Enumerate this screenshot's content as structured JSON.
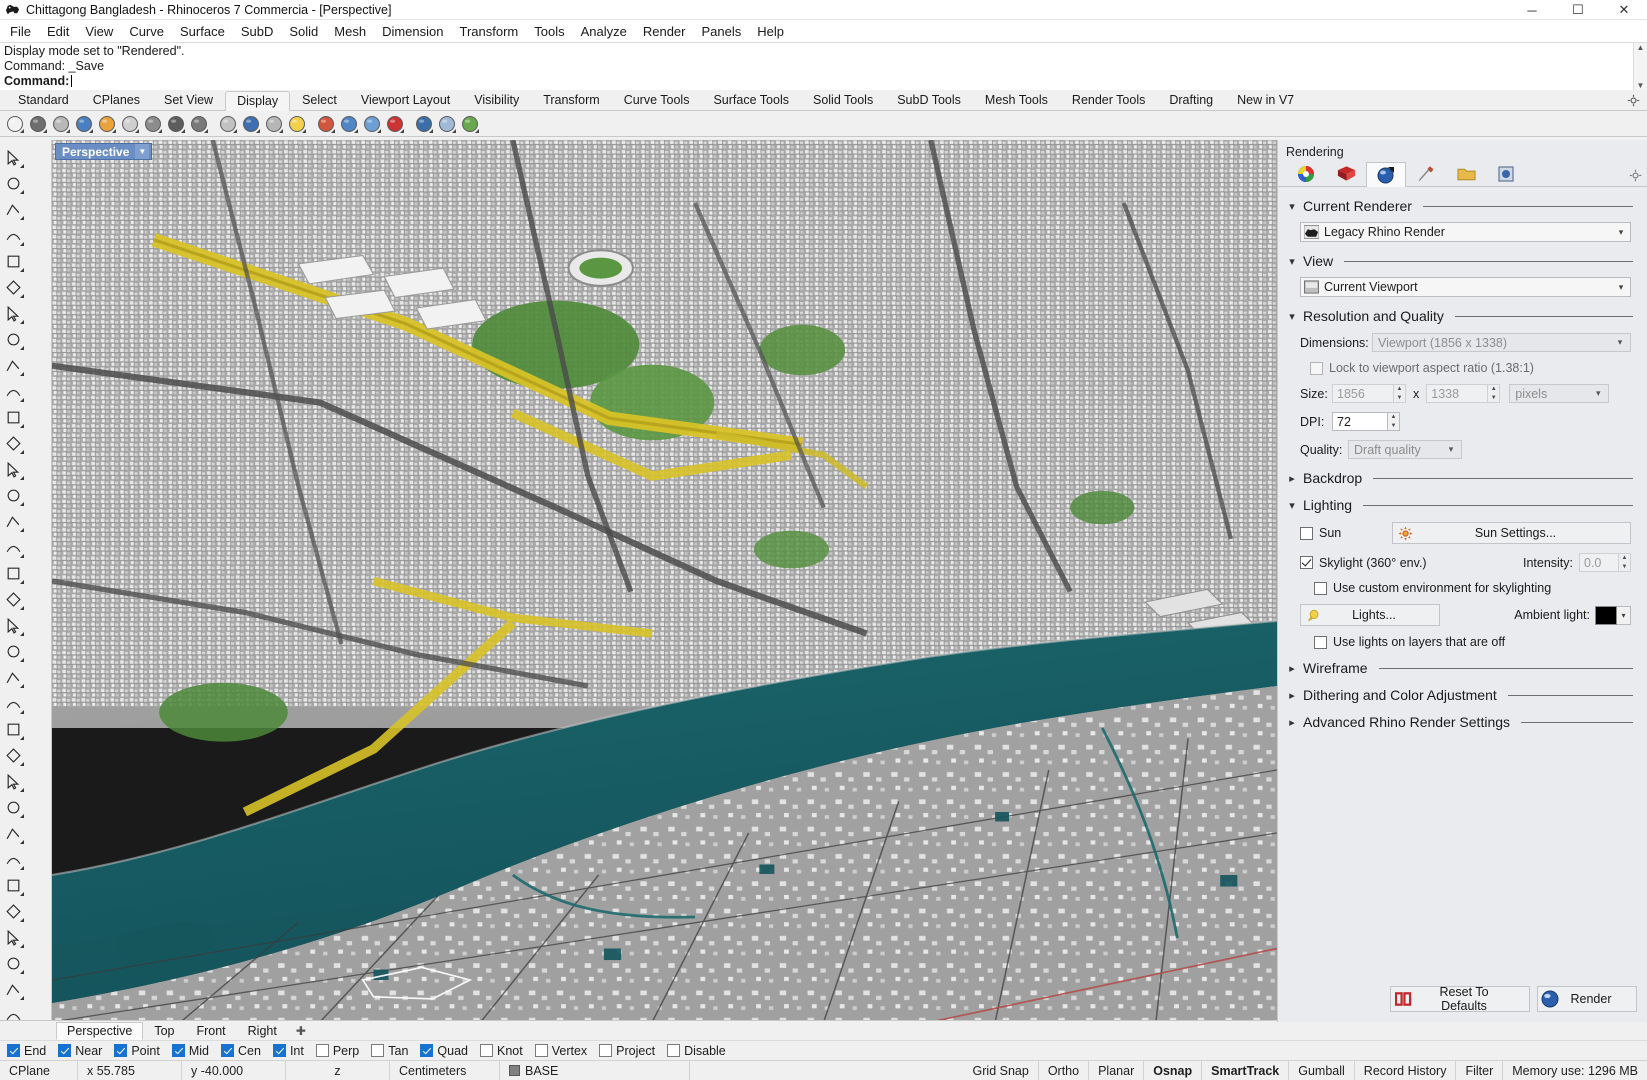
{
  "window": {
    "title": "Chittagong Bangladesh - Rhinoceros 7 Commercia - [Perspective]",
    "app_icon": "rhino-logo-icon",
    "minimize": "─",
    "maximize": "☐",
    "close": "✕"
  },
  "menu": {
    "items": [
      "File",
      "Edit",
      "View",
      "Curve",
      "Surface",
      "SubD",
      "Solid",
      "Mesh",
      "Dimension",
      "Transform",
      "Tools",
      "Analyze",
      "Render",
      "Panels",
      "Help"
    ]
  },
  "command_area": {
    "history": [
      "Display mode set to \"Rendered\".",
      "Command: _Save"
    ],
    "prompt": "Command:",
    "input_value": "",
    "scroll_up": "▲",
    "scroll_down": "▼"
  },
  "toolbar_tabs": {
    "items": [
      "Standard",
      "CPlanes",
      "Set View",
      "Display",
      "Select",
      "Viewport Layout",
      "Visibility",
      "Transform",
      "Curve Tools",
      "Surface Tools",
      "Solid Tools",
      "SubD Tools",
      "Mesh Tools",
      "Render Tools",
      "Drafting",
      "New in V7"
    ],
    "active": "Display",
    "options_icon": "gear-icon"
  },
  "display_toolbar": {
    "icons": [
      {
        "name": "wireframe-display-icon",
        "color": "#f2f2f2"
      },
      {
        "name": "shaded-display-icon",
        "color": "#6e6e6e"
      },
      {
        "name": "ghosted-display-icon",
        "color": "#b8b8b8"
      },
      {
        "name": "rendered-display-icon",
        "color": "#4a7fc1"
      },
      {
        "name": "arctic-display-icon",
        "color": "#e8a33d"
      },
      {
        "name": "xray-display-icon",
        "color": "#cfcfcf"
      },
      {
        "name": "technical-display-icon",
        "color": "#8c8c8c"
      },
      {
        "name": "pen-display-icon",
        "color": "#5d5d5d"
      },
      {
        "name": "raytraced-display-icon",
        "color": "#7a7a7a"
      },
      {
        "name": "shade-viewport-icon",
        "color": "#c2c2c2"
      },
      {
        "name": "render-in-window-icon",
        "color": "#3f6fb0"
      },
      {
        "name": "render-preview-icon",
        "color": "#b6b6b6"
      },
      {
        "name": "sun-icon",
        "color": "#f3d04a"
      },
      {
        "name": "color-wheel-icon",
        "color": "#d0563d"
      },
      {
        "name": "environment-icon",
        "color": "#4f86c6"
      },
      {
        "name": "ground-plane-icon",
        "color": "#6d9fd4"
      },
      {
        "name": "render-cancel-icon",
        "color": "#cc3333"
      },
      {
        "name": "viewport-properties-icon",
        "color": "#3c6fa8"
      },
      {
        "name": "display-options-icon",
        "color": "#9fb9d6"
      },
      {
        "name": "capture-viewport-icon",
        "color": "#6aa84f"
      }
    ]
  },
  "left_toolbar": {
    "icons": [
      {
        "name": "select-arrow-icon"
      },
      {
        "name": "point-object-icon"
      },
      {
        "name": "polyline-icon"
      },
      {
        "name": "control-point-curve-icon"
      },
      {
        "name": "circle-icon"
      },
      {
        "name": "ellipse-icon"
      },
      {
        "name": "arc-icon"
      },
      {
        "name": "rectangle-icon"
      },
      {
        "name": "polygon-icon"
      },
      {
        "name": "curve-tools-icon"
      },
      {
        "name": "surface-from-points-icon"
      },
      {
        "name": "extrude-surface-icon"
      },
      {
        "name": "loft-surface-icon"
      },
      {
        "name": "revolve-surface-icon"
      },
      {
        "name": "box-solid-icon"
      },
      {
        "name": "sphere-solid-icon"
      },
      {
        "name": "cylinder-solid-icon"
      },
      {
        "name": "cone-solid-icon"
      },
      {
        "name": "mesh-tools-icon"
      },
      {
        "name": "subd-tools-icon"
      },
      {
        "name": "boolean-union-icon"
      },
      {
        "name": "boolean-difference-icon"
      },
      {
        "name": "trim-icon"
      },
      {
        "name": "split-icon"
      },
      {
        "name": "text-icon"
      },
      {
        "name": "dimension-icon"
      },
      {
        "name": "linear-dimension-icon"
      },
      {
        "name": "leader-icon"
      },
      {
        "name": "hatch-icon"
      },
      {
        "name": "analyze-icon"
      },
      {
        "name": "array-icon"
      },
      {
        "name": "transform-icon"
      },
      {
        "name": "gumball-icon"
      },
      {
        "name": "check-icon"
      },
      {
        "name": "layer-icon"
      },
      {
        "name": "render-material-icon"
      }
    ]
  },
  "viewport": {
    "label": "Perspective",
    "dropdown_arrow": "▼",
    "tabs": [
      "Perspective",
      "Top",
      "Front",
      "Right"
    ],
    "active_tab": "Perspective",
    "add_tab_icon": "add-viewport-icon",
    "scene_description": "Rendered aerial 3D city model of Chittagong, Bangladesh with river",
    "colors": {
      "ground": "#a9a9a9",
      "water": "#16595e",
      "road_highlight": "#d8c227",
      "vegetation": "#4f8b3b",
      "building": "#e8e8e8"
    }
  },
  "right_panel": {
    "title": "Rendering",
    "tabs": [
      {
        "name": "materials-tab",
        "icon": "color-wheel-icon",
        "active": false
      },
      {
        "name": "environments-tab",
        "icon": "environment-icon",
        "active": false
      },
      {
        "name": "rendering-tab",
        "icon": "render-sphere-icon",
        "active": true
      },
      {
        "name": "ground-plane-tab",
        "icon": "brush-icon",
        "active": false
      },
      {
        "name": "libraries-tab",
        "icon": "folder-icon",
        "active": false
      },
      {
        "name": "render-window-tab",
        "icon": "picture-icon",
        "active": false
      }
    ],
    "options_icon": "gear-icon",
    "sections": {
      "current_renderer": {
        "title": "Current Renderer",
        "expanded": true,
        "value": "Legacy Rhino Render",
        "icon": "rhino-render-icon"
      },
      "view": {
        "title": "View",
        "expanded": true,
        "value": "Current Viewport",
        "icon": "viewport-icon"
      },
      "resolution_and_quality": {
        "title": "Resolution and Quality",
        "expanded": true,
        "dimensions_label": "Dimensions:",
        "dimensions_value": "Viewport (1856 x 1338)",
        "lock_aspect_label": "Lock to viewport aspect ratio (1.38:1)",
        "lock_aspect_checked": false,
        "size_label": "Size:",
        "size_width": "1856",
        "size_separator": "x",
        "size_height": "1338",
        "size_units": "pixels",
        "dpi_label": "DPI:",
        "dpi_value": "72",
        "quality_label": "Quality:",
        "quality_value": "Draft quality"
      },
      "backdrop": {
        "title": "Backdrop",
        "expanded": false
      },
      "lighting": {
        "title": "Lighting",
        "expanded": true,
        "sun_label": "Sun",
        "sun_checked": false,
        "sun_settings_label": "Sun Settings...",
        "sun_icon": "sun-icon",
        "skylight_label": "Skylight (360° env.)",
        "skylight_checked": true,
        "intensity_label": "Intensity:",
        "intensity_value": "0.0",
        "custom_env_label": "Use custom environment for skylighting",
        "custom_env_checked": false,
        "lights_label": "Lights...",
        "lights_icon": "lightbulb-icon",
        "ambient_label": "Ambient light:",
        "ambient_color": "#000000",
        "lights_off_label": "Use lights on layers that are off",
        "lights_off_checked": false
      },
      "wireframe": {
        "title": "Wireframe",
        "expanded": false
      },
      "dithering": {
        "title": "Dithering and Color Adjustment",
        "expanded": false
      },
      "advanced": {
        "title": "Advanced Rhino Render Settings",
        "expanded": false
      }
    },
    "footer": {
      "reset_label": "Reset To Defaults",
      "reset_icon": "reset-defaults-icon",
      "render_label": "Render",
      "render_icon": "render-sphere-icon"
    }
  },
  "osnap_bar": {
    "items": [
      {
        "label": "End",
        "checked": true
      },
      {
        "label": "Near",
        "checked": true
      },
      {
        "label": "Point",
        "checked": true
      },
      {
        "label": "Mid",
        "checked": true
      },
      {
        "label": "Cen",
        "checked": true
      },
      {
        "label": "Int",
        "checked": true
      },
      {
        "label": "Perp",
        "checked": false
      },
      {
        "label": "Tan",
        "checked": false
      },
      {
        "label": "Quad",
        "checked": true
      },
      {
        "label": "Knot",
        "checked": false
      },
      {
        "label": "Vertex",
        "checked": false
      },
      {
        "label": "Project",
        "checked": false
      },
      {
        "label": "Disable",
        "checked": false
      }
    ]
  },
  "status_bar": {
    "cplane": "CPlane",
    "x": "x 55.785",
    "y": "y -40.000",
    "z": "z",
    "units": "Centimeters",
    "layer": "BASE",
    "layer_color": "#808080",
    "toggles": [
      {
        "label": "Grid Snap",
        "active": false
      },
      {
        "label": "Ortho",
        "active": false
      },
      {
        "label": "Planar",
        "active": false
      },
      {
        "label": "Osnap",
        "active": true
      },
      {
        "label": "SmartTrack",
        "active": true
      },
      {
        "label": "Gumball",
        "active": false
      },
      {
        "label": "Record History",
        "active": false
      },
      {
        "label": "Filter",
        "active": false
      }
    ],
    "memory": "Memory use: 1296 MB"
  }
}
